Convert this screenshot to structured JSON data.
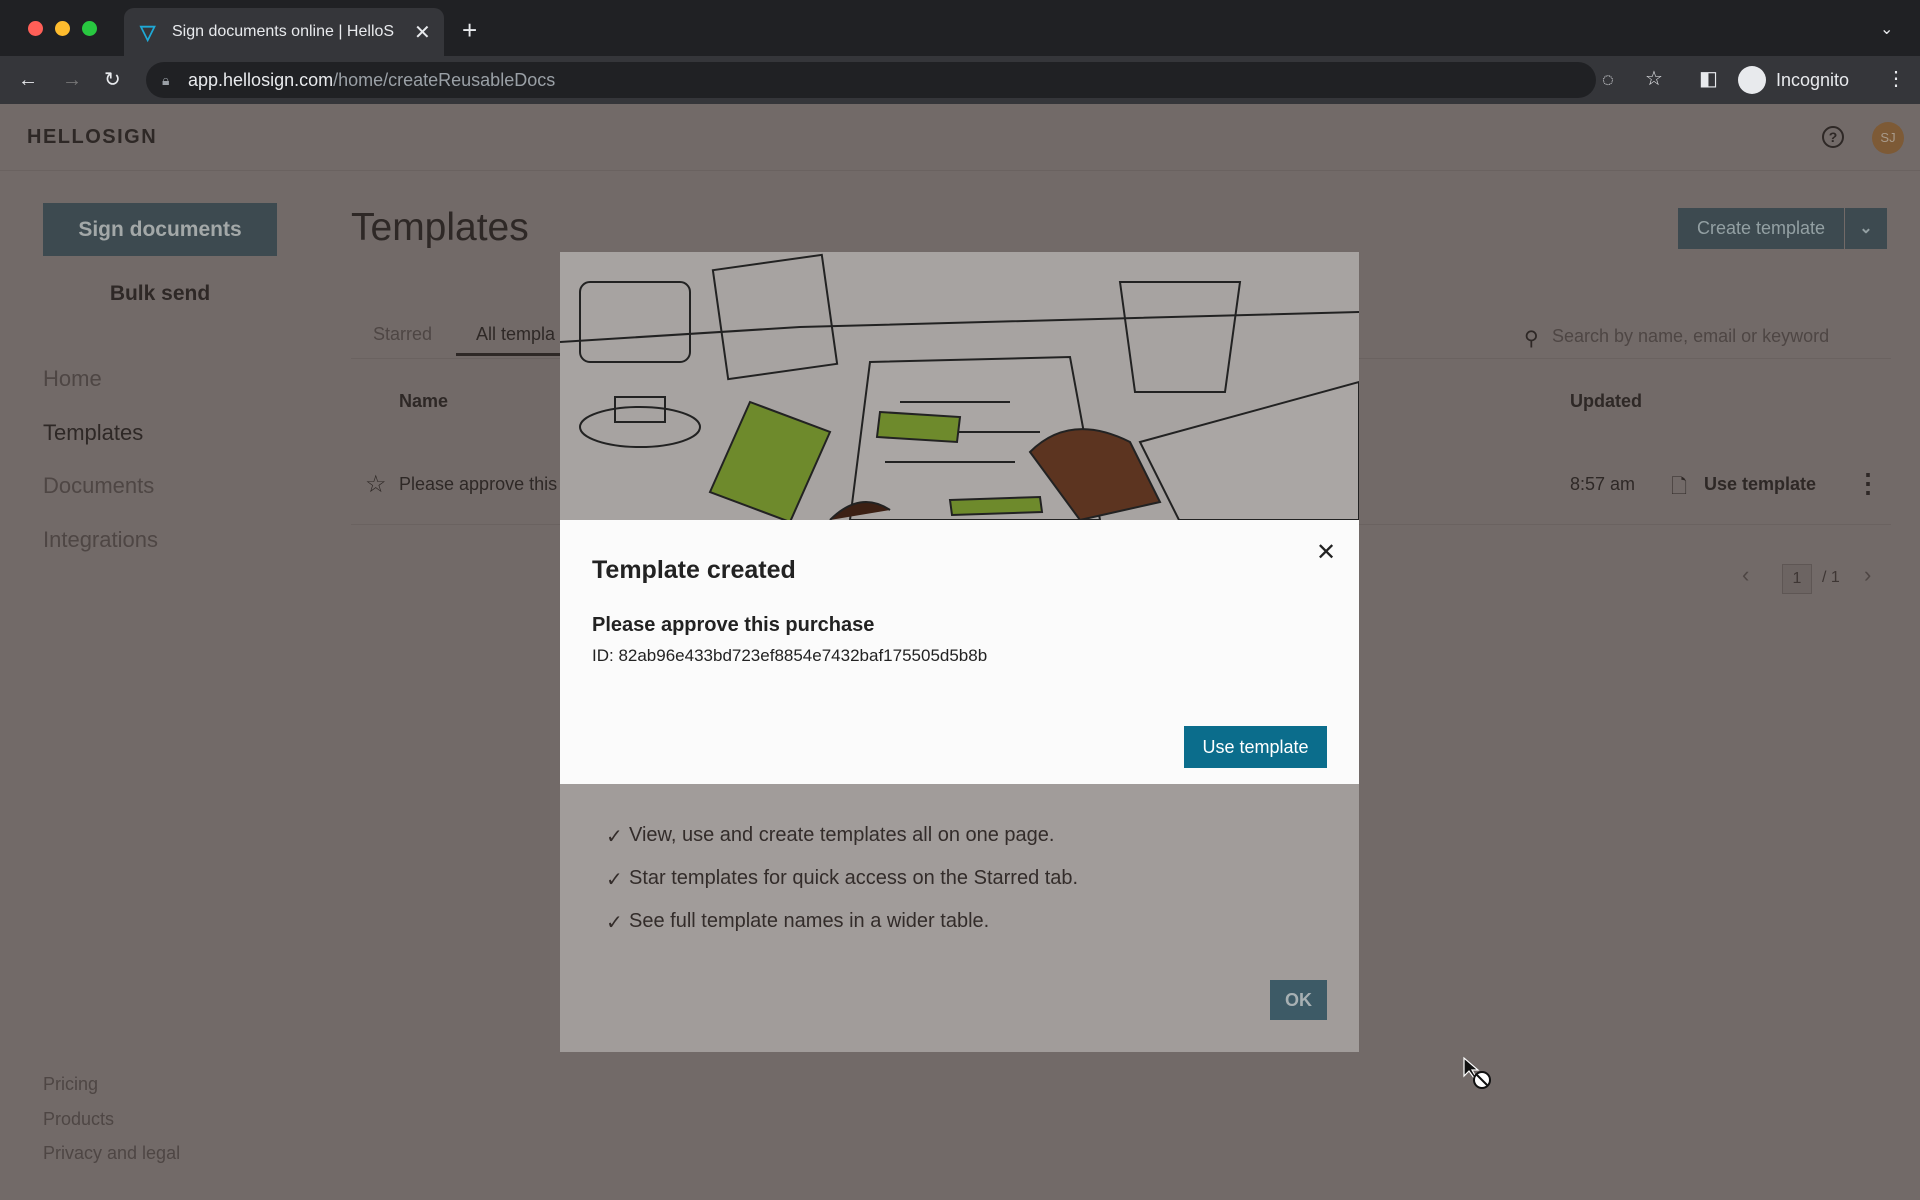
{
  "browser": {
    "tab_title": "Sign documents online | HelloS",
    "url_host": "app.hellosign.com",
    "url_path": "/home/createReusableDocs",
    "profile_label": "Incognito"
  },
  "app": {
    "logo": "HELLOSIGN",
    "avatar_initials": "SJ",
    "sidebar": {
      "sign_documents": "Sign documents",
      "bulk_send": "Bulk send",
      "items": [
        {
          "label": "Home"
        },
        {
          "label": "Templates"
        },
        {
          "label": "Documents"
        },
        {
          "label": "Integrations"
        }
      ],
      "footer": [
        {
          "label": "Pricing"
        },
        {
          "label": "Products"
        },
        {
          "label": "Privacy and legal"
        }
      ]
    },
    "main": {
      "title": "Templates",
      "create_template": "Create template",
      "tabs": [
        {
          "label": "Starred"
        },
        {
          "label": "All templa"
        }
      ],
      "search_placeholder": "Search by name, email or keyword",
      "columns": {
        "name": "Name",
        "updated": "Updated"
      },
      "rows": [
        {
          "name": "Please approve this",
          "updated": "8:57 am",
          "action": "Use template"
        }
      ],
      "pagination": {
        "current": "1",
        "total": "/ 1"
      }
    }
  },
  "background_modal": {
    "features": [
      "View, use and create templates all on one page.",
      "Star templates for quick access on the Starred tab.",
      "See full template names in a wider table."
    ],
    "ok": "OK"
  },
  "dialog": {
    "title": "Template created",
    "template_name": "Please approve this purchase",
    "template_id": "ID: 82ab96e433bd723ef8854e7432baf175505d5b8b",
    "use_template": "Use template"
  },
  "colors": {
    "primary": "#0b6d8c",
    "illustration_green": "#a6cf3a"
  }
}
